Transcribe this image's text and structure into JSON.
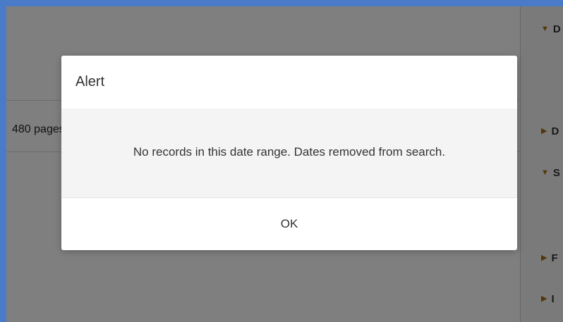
{
  "background": {
    "pages_text": "480 pages",
    "facets": [
      {
        "expanded": true,
        "label": "D"
      },
      {
        "expanded": false,
        "label": "D"
      },
      {
        "expanded": true,
        "label": "S"
      },
      {
        "expanded": false,
        "label": "F"
      },
      {
        "expanded": false,
        "label": "I"
      }
    ]
  },
  "alert": {
    "title": "Alert",
    "message": "No records in this date range. Dates removed from search.",
    "ok_label": "OK"
  },
  "colors": {
    "facet_triangle": "#a36d12",
    "overlay": "rgba(0,0,0,0.5)",
    "frame_border": "#4a7bc8"
  }
}
